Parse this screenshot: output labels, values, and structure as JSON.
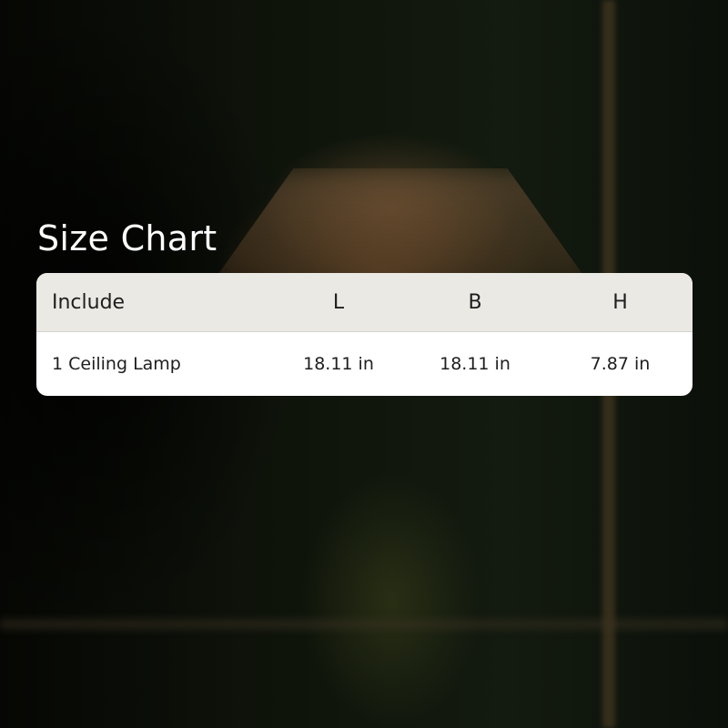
{
  "title": "Size Chart",
  "table": {
    "headers": [
      "Include",
      "L",
      "B",
      "H"
    ],
    "rows": [
      [
        "1 Ceiling Lamp",
        "18.11 in",
        "18.11 in",
        "7.87 in"
      ]
    ]
  },
  "colors": {
    "header_bg": "#ebe9e4",
    "card_bg": "#ffffff",
    "text": "#1e1e1e",
    "title_text": "#ffffff"
  }
}
